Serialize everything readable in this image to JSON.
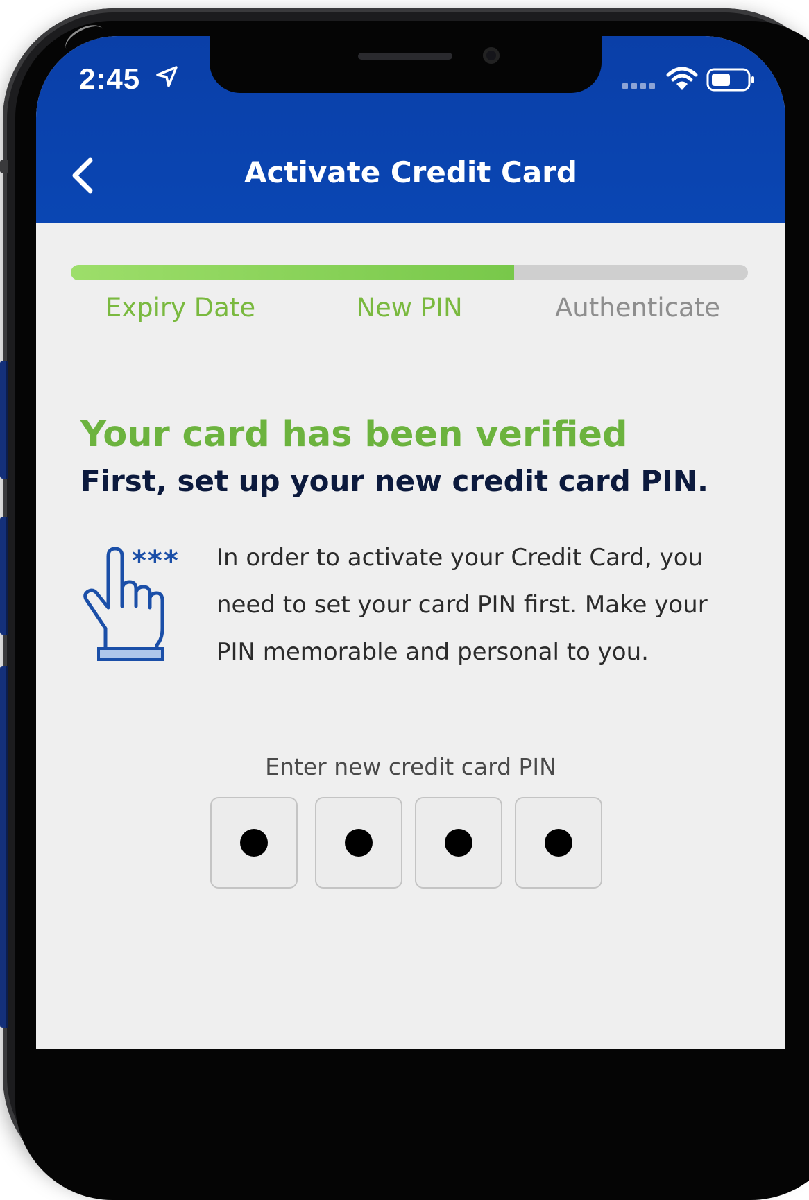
{
  "status_bar": {
    "time": "2:45"
  },
  "header": {
    "title": "Activate Credit Card"
  },
  "stepper": {
    "progress": 0.655,
    "steps": [
      {
        "label": "Expiry Date",
        "state": "done"
      },
      {
        "label": "New PIN",
        "state": "current"
      },
      {
        "label": "Authenticate",
        "state": "todo"
      }
    ]
  },
  "content": {
    "headline": "Your card has been verified",
    "subheadline": "First, set up your new credit card PIN.",
    "body": "In order to activate your Credit Card, you need to set your card PIN first. Make your PIN memorable and personal to you.",
    "icon_asterisks": "***"
  },
  "pin": {
    "label": "Enter new credit card PIN",
    "digits_entered": 4,
    "length": 4
  },
  "colors": {
    "header_blue": "#0a46b3",
    "accent_green": "#6cb33e",
    "progress_green": "#8fd35a",
    "icon_blue": "#1b4fa8"
  },
  "icons": {
    "back": "chevron-left-icon",
    "location": "location-arrow-icon",
    "wifi": "wifi-icon",
    "battery": "battery-icon",
    "pin_hand": "hand-pointer-icon"
  }
}
